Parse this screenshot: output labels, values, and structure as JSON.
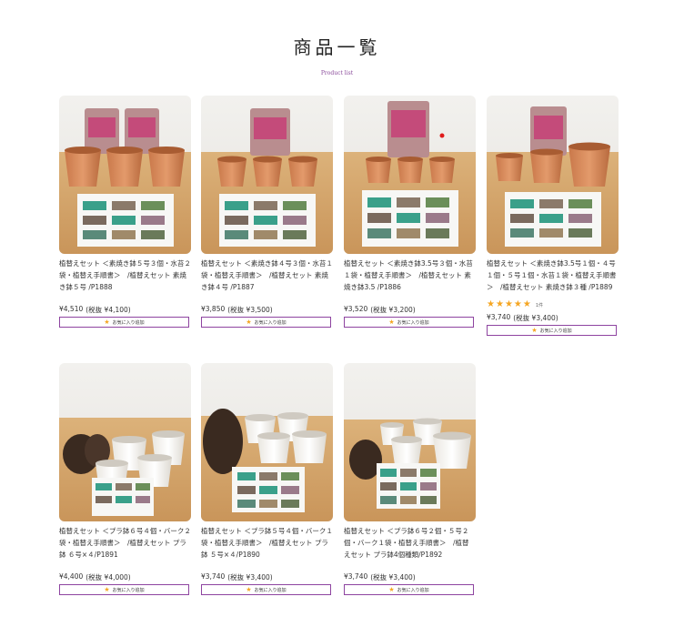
{
  "header": {
    "title": "商品一覧",
    "subtitle": "Product list"
  },
  "fav_label": "お気に入り追加",
  "products": [
    {
      "name": "植替えセット ＜素焼き鉢５号３個・水苔２袋・植替え手順書＞　/植替えセット 素焼き鉢５号 /P1888",
      "price": "¥4,510",
      "price_tax": "(税抜 ¥4,100)"
    },
    {
      "name": "植替えセット ＜素焼き鉢４号３個・水苔１袋・植替え手順書＞　/植替えセット 素焼き鉢４号 /P1887",
      "price": "¥3,850",
      "price_tax": "(税抜 ¥3,500)"
    },
    {
      "name": "植替えセット ＜素焼き鉢3.5号３個・水苔１袋・植替え手順書＞　/植替えセット 素焼き鉢3.5 /P1886",
      "price": "¥3,520",
      "price_tax": "(税抜 ¥3,200)"
    },
    {
      "name": "植替えセット ＜素焼き鉢3.5号１個・４号１個・５号１個・水苔１袋・植替え手順書＞　/植替えセット 素焼き鉢３種 /P1889",
      "price": "¥3,740",
      "price_tax": "(税抜 ¥3,400)",
      "rating": 5,
      "rating_count": "1件"
    },
    {
      "name": "植替えセット ＜プラ鉢６号４個・バーク２袋・植替え手順書＞　/植替えセット プラ鉢 ６号×４/P1891",
      "price": "¥4,400",
      "price_tax": "(税抜 ¥4,000)"
    },
    {
      "name": "植替えセット ＜プラ鉢５号４個・バーク１袋・植替え手順書＞　/植替えセット プラ鉢 ５号×４/P1890",
      "price": "¥3,740",
      "price_tax": "(税抜 ¥3,400)"
    },
    {
      "name": "植替えセット ＜プラ鉢６号２個・５号２個・バーク１袋・植替え手順書＞　/植替えセット プラ鉢4個種類/P1892",
      "price": "¥3,740",
      "price_tax": "(税抜 ¥3,400)"
    }
  ]
}
